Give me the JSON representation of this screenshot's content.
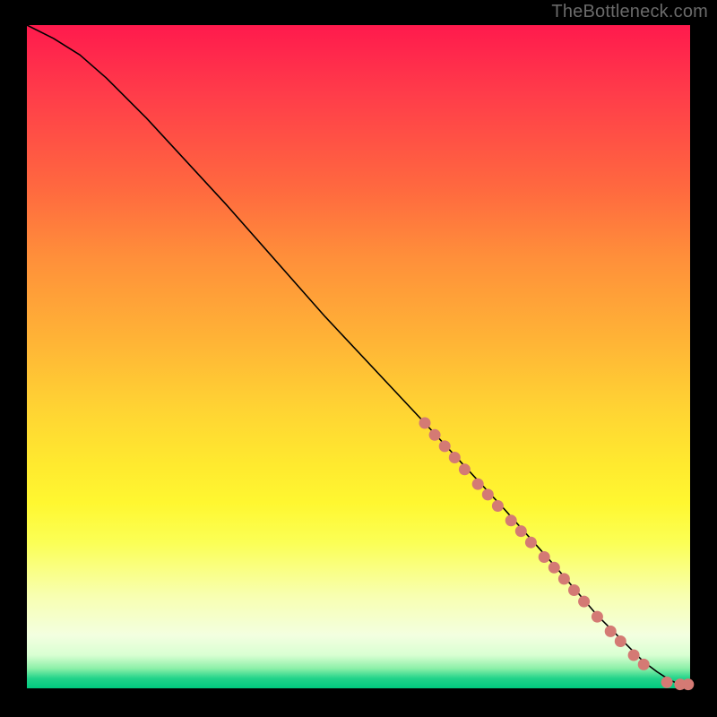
{
  "watermark": "TheBottleneck.com",
  "colors": {
    "page_bg": "#000000",
    "dot_fill": "#d47a74",
    "curve_stroke": "#000000",
    "gradient_top": "#ff1a4d",
    "gradient_mid": "#fff730",
    "gradient_bottom": "#00c97e"
  },
  "chart_data": {
    "type": "line",
    "title": "",
    "xlabel": "",
    "ylabel": "",
    "xlim": [
      0,
      100
    ],
    "ylim": [
      0,
      100
    ],
    "grid": false,
    "legend": false,
    "series": [
      {
        "name": "curve",
        "x": [
          0,
          4,
          8,
          12,
          18,
          30,
          45,
          60,
          72,
          80,
          86,
          90,
          93,
          95,
          97,
          98.5,
          100
        ],
        "y": [
          100,
          98,
          95.5,
          92,
          86,
          73,
          56,
          40,
          27,
          18,
          11,
          7,
          4,
          2.5,
          1.2,
          0.6,
          0.5
        ]
      }
    ],
    "points": [
      {
        "x": 60.0,
        "y": 40.0
      },
      {
        "x": 61.5,
        "y": 38.2
      },
      {
        "x": 63.0,
        "y": 36.5
      },
      {
        "x": 64.5,
        "y": 34.8
      },
      {
        "x": 66.0,
        "y": 33.0
      },
      {
        "x": 68.0,
        "y": 30.8
      },
      {
        "x": 69.5,
        "y": 29.2
      },
      {
        "x": 71.0,
        "y": 27.5
      },
      {
        "x": 73.0,
        "y": 25.3
      },
      {
        "x": 74.5,
        "y": 23.7
      },
      {
        "x": 76.0,
        "y": 22.0
      },
      {
        "x": 78.0,
        "y": 19.8
      },
      {
        "x": 79.5,
        "y": 18.2
      },
      {
        "x": 81.0,
        "y": 16.5
      },
      {
        "x": 82.5,
        "y": 14.8
      },
      {
        "x": 84.0,
        "y": 13.1
      },
      {
        "x": 86.0,
        "y": 10.8
      },
      {
        "x": 88.0,
        "y": 8.6
      },
      {
        "x": 89.5,
        "y": 7.1
      },
      {
        "x": 91.5,
        "y": 5.0
      },
      {
        "x": 93.0,
        "y": 3.6
      },
      {
        "x": 96.5,
        "y": 0.9
      },
      {
        "x": 98.5,
        "y": 0.6
      },
      {
        "x": 99.7,
        "y": 0.6
      }
    ]
  }
}
